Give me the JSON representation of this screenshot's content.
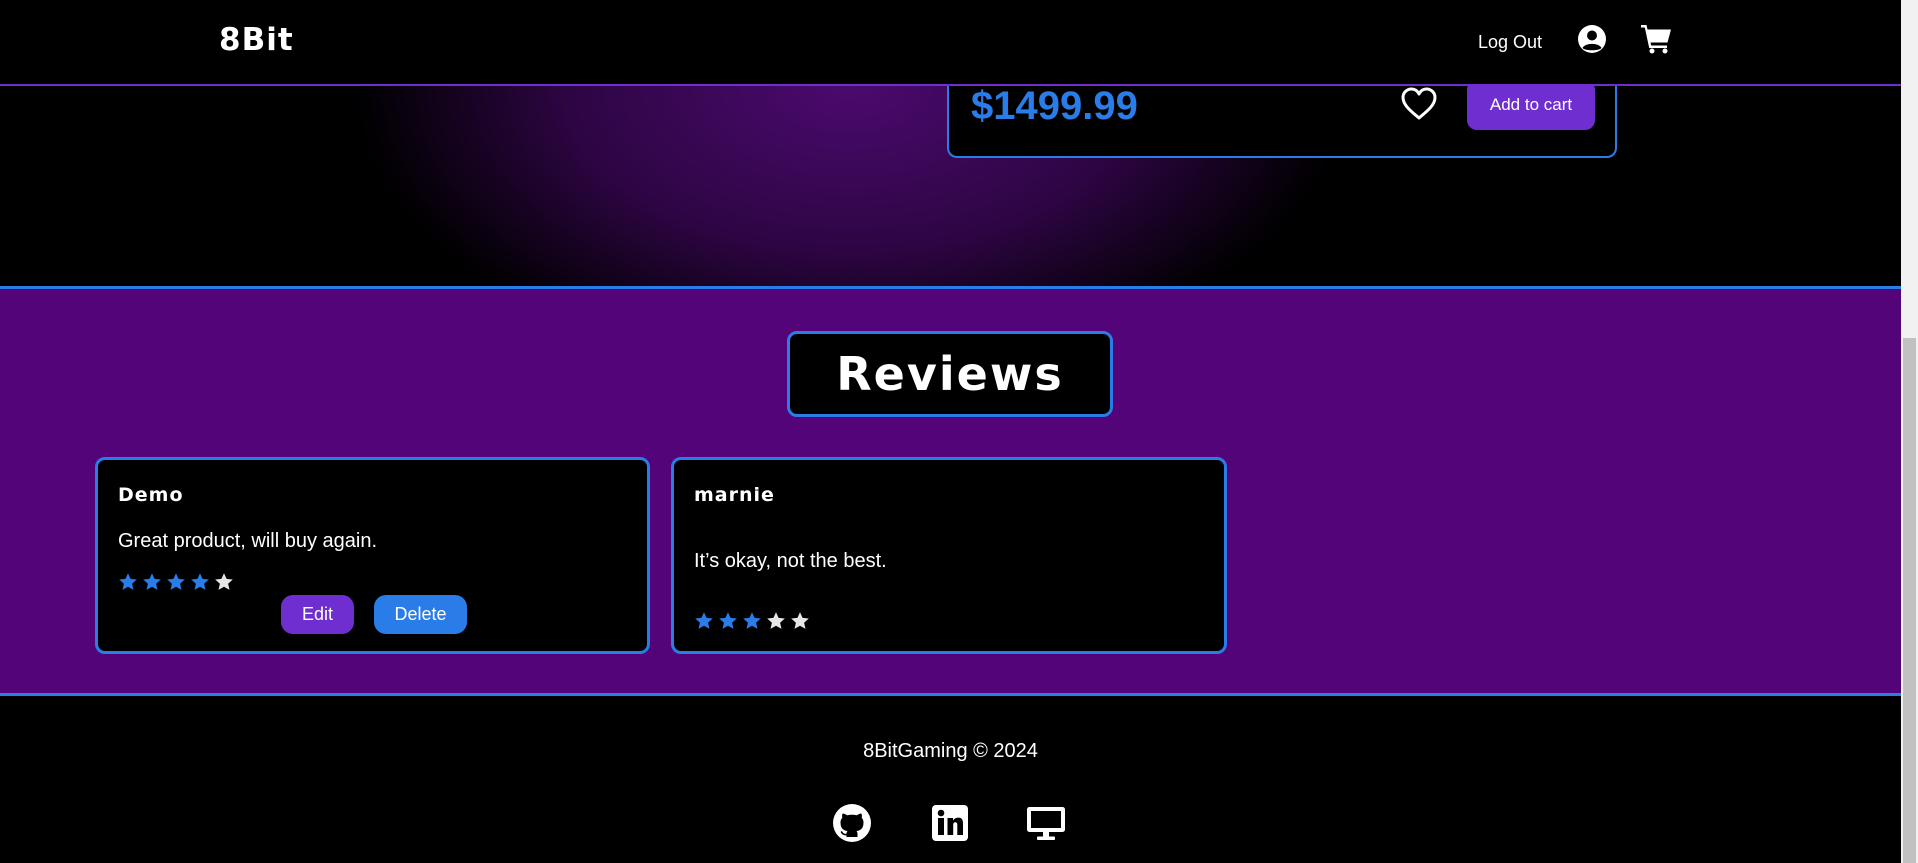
{
  "header": {
    "logo": "8Bit",
    "logout_label": "Log Out",
    "icons": [
      "user-circle-icon",
      "cart-icon"
    ]
  },
  "product": {
    "price": "$1499.99",
    "add_to_cart_label": "Add to cart",
    "favorite_icon": "heart-outline-icon"
  },
  "reviews": {
    "title": "Reviews",
    "items": [
      {
        "user": "Demo",
        "text": "Great product, will buy again.",
        "rating": 4,
        "max_rating": 5,
        "edit_label": "Edit",
        "delete_label": "Delete"
      },
      {
        "user": "marnie",
        "text": "It’s okay, not the best.",
        "rating": 3,
        "max_rating": 5
      }
    ]
  },
  "footer": {
    "copyright": "8BitGaming © 2024",
    "icons": [
      "github-icon",
      "linkedin-icon",
      "monitor-icon"
    ]
  },
  "colors": {
    "accent_purple": "#6f2fd0",
    "accent_blue": "#2a7de9",
    "section_purple": "#520478",
    "star_filled": "#2a7de9",
    "star_empty": "#e6e6e6"
  }
}
